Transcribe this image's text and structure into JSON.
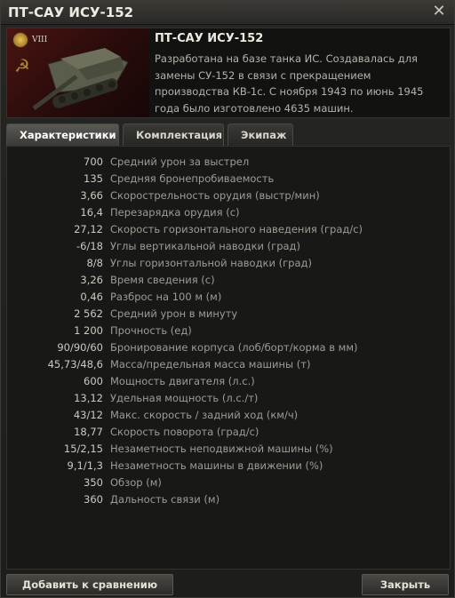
{
  "window": {
    "title": "ПТ-САУ ИСУ-152"
  },
  "tank": {
    "tier": "VIII",
    "name": "ПТ-САУ ИСУ-152",
    "description": "Разработана на базе танка ИС. Создавалась для замены СУ-152 в связи с прекращением производства КВ-1с. С ноября 1943 по июнь 1945 года было изготовлено 4635 машин."
  },
  "tabs": [
    {
      "label": "Характеристики",
      "active": true
    },
    {
      "label": "Комплектация",
      "active": false
    },
    {
      "label": "Экипаж",
      "active": false
    }
  ],
  "stats": [
    {
      "value": "700",
      "label": "Средний урон за выстрел"
    },
    {
      "value": "135",
      "label": "Средняя бронепробиваемость"
    },
    {
      "value": "3,66",
      "label": "Скорострельность орудия (выстр/мин)"
    },
    {
      "value": "16,4",
      "label": "Перезарядка орудия (с)"
    },
    {
      "value": "27,12",
      "label": "Скорость горизонтального наведения (град/с)"
    },
    {
      "value": "-6/18",
      "label": "Углы вертикальной наводки (град)"
    },
    {
      "value": "8/8",
      "label": "Углы горизонтальной наводки (град)"
    },
    {
      "value": "3,26",
      "label": "Время сведения (с)"
    },
    {
      "value": "0,46",
      "label": "Разброс на 100 м (м)"
    },
    {
      "value": "2 562",
      "label": "Средний урон в минуту"
    },
    {
      "value": "1 200",
      "label": "Прочность (ед)"
    },
    {
      "value": "90/90/60",
      "label": "Бронирование корпуса (лоб/борт/корма в мм)"
    },
    {
      "value": "45,73/48,6",
      "label": "Масса/предельная масса машины (т)"
    },
    {
      "value": "600",
      "label": "Мощность двигателя (л.с.)"
    },
    {
      "value": "13,12",
      "label": "Удельная мощность (л.с./т)"
    },
    {
      "value": "43/12",
      "label": "Макс. скорость / задний ход (км/ч)"
    },
    {
      "value": "18,77",
      "label": "Скорость поворота (град/с)"
    },
    {
      "value": "15/2,15",
      "label": "Незаметность неподвижной машины (%)"
    },
    {
      "value": "9,1/1,3",
      "label": "Незаметность машины в движении (%)"
    },
    {
      "value": "350",
      "label": "Обзор (м)"
    },
    {
      "value": "360",
      "label": "Дальность связи (м)"
    }
  ],
  "footer": {
    "compare_label": "Добавить к сравнению",
    "close_label": "Закрыть"
  },
  "icons": {
    "close": "close-icon",
    "medal": "medal-icon",
    "flag": "hammer-sickle-icon"
  }
}
